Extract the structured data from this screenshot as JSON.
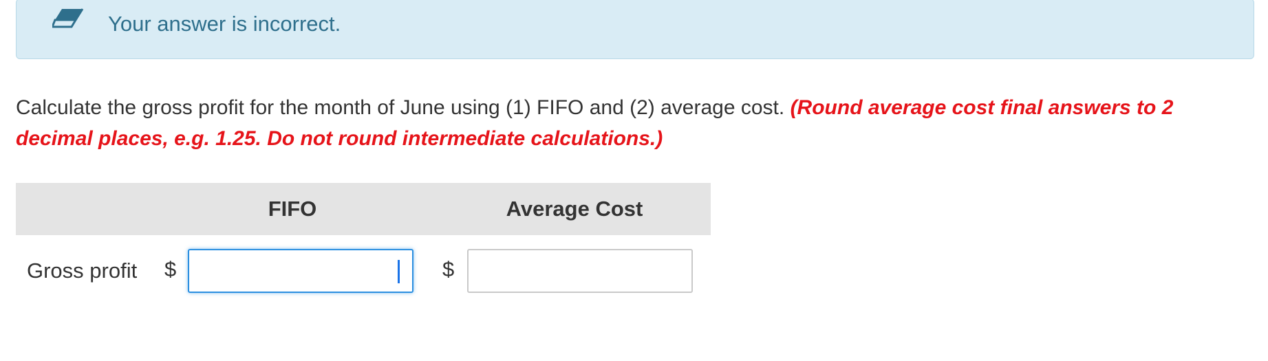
{
  "alert": {
    "icon": "eraser-icon",
    "message": "Your answer is incorrect.",
    "color": "#2e6f8c",
    "background": "#d9ecf5"
  },
  "question": {
    "text": "Calculate the gross profit for the month of June using (1) FIFO and (2) average cost.",
    "note": "(Round average cost final answers to 2 decimal places, e.g. 1.25. Do not round intermediate calculations.)",
    "note_color": "#e6141a"
  },
  "table": {
    "columns": [
      "FIFO",
      "Average Cost"
    ],
    "rows": [
      {
        "label": "Gross profit",
        "currency": "$",
        "fifo_value": "",
        "average_cost_value": ""
      }
    ]
  }
}
